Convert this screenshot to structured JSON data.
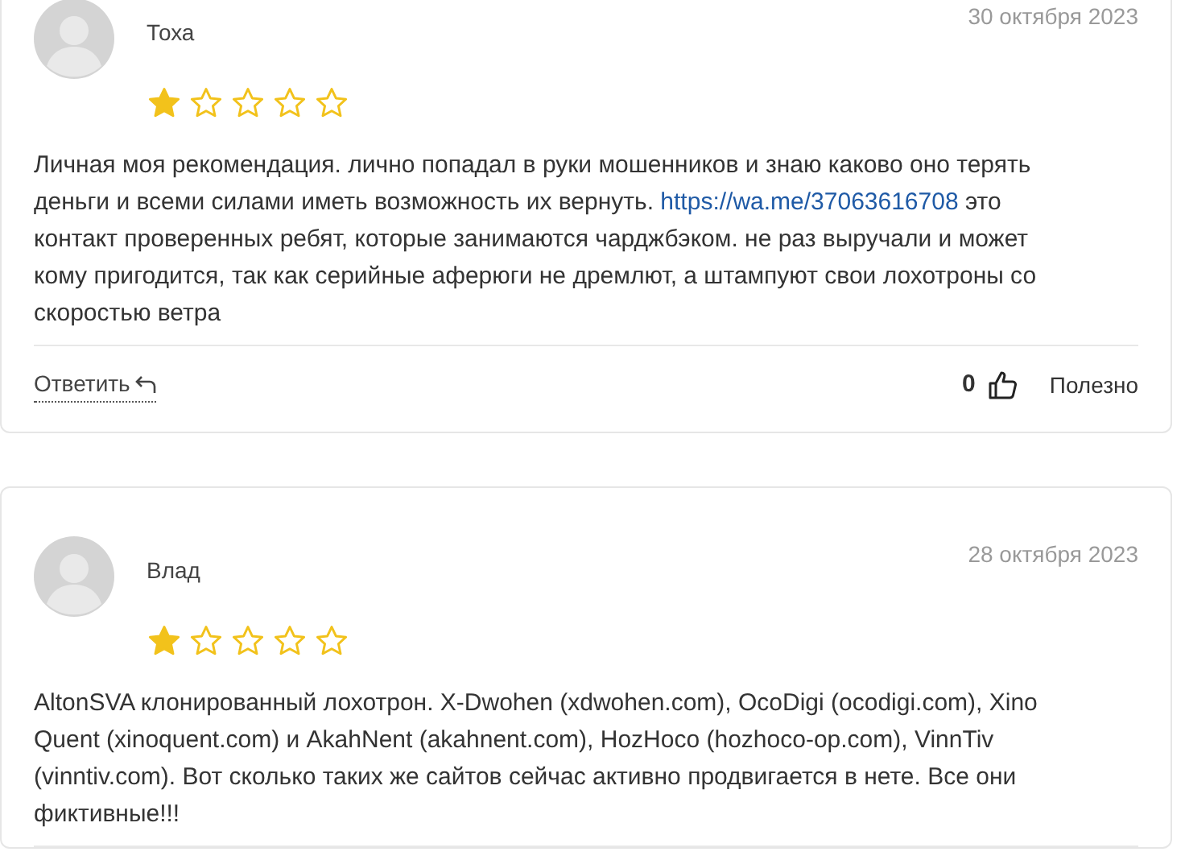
{
  "reviews": [
    {
      "author": "Тоха",
      "date": "30 октября 2023",
      "stars": 1,
      "body": [
        {
          "kind": "text",
          "text": "Личная моя рекомендация. лично попадал в руки мошенников и знаю каково оно терять деньги и всеми силами иметь возможность их вернуть. "
        },
        {
          "kind": "link",
          "text": "https://wa.me/37063616708"
        },
        {
          "kind": "text",
          "text": " это контакт проверенных ребят, которые занимаются чарджбэком. не раз выручали и может кому пригодится, так как серийные аферюги не дремлют, а штампуют свои лохотроны со скоростью ветра"
        }
      ],
      "reply_label": "Ответить",
      "helpful_count": "0",
      "helpful_label": "Полезно"
    },
    {
      "author": "Влад",
      "date": "28 октября 2023",
      "stars": 1,
      "body": [
        {
          "kind": "text",
          "text": "AltonSVA клонированный лохотрон. X-Dwohen (xdwohen.com), OcoDigi (ocodigi.com), Xino Quent (xinoquent.com) и AkahNent (akahnent.com), HozHoco (hozhoco-op.com), VinnTiv (vinntiv.com). Вот сколько таких же сайтов сейчас активно продвигается в нете. Все они фиктивные!!!"
        }
      ]
    }
  ]
}
